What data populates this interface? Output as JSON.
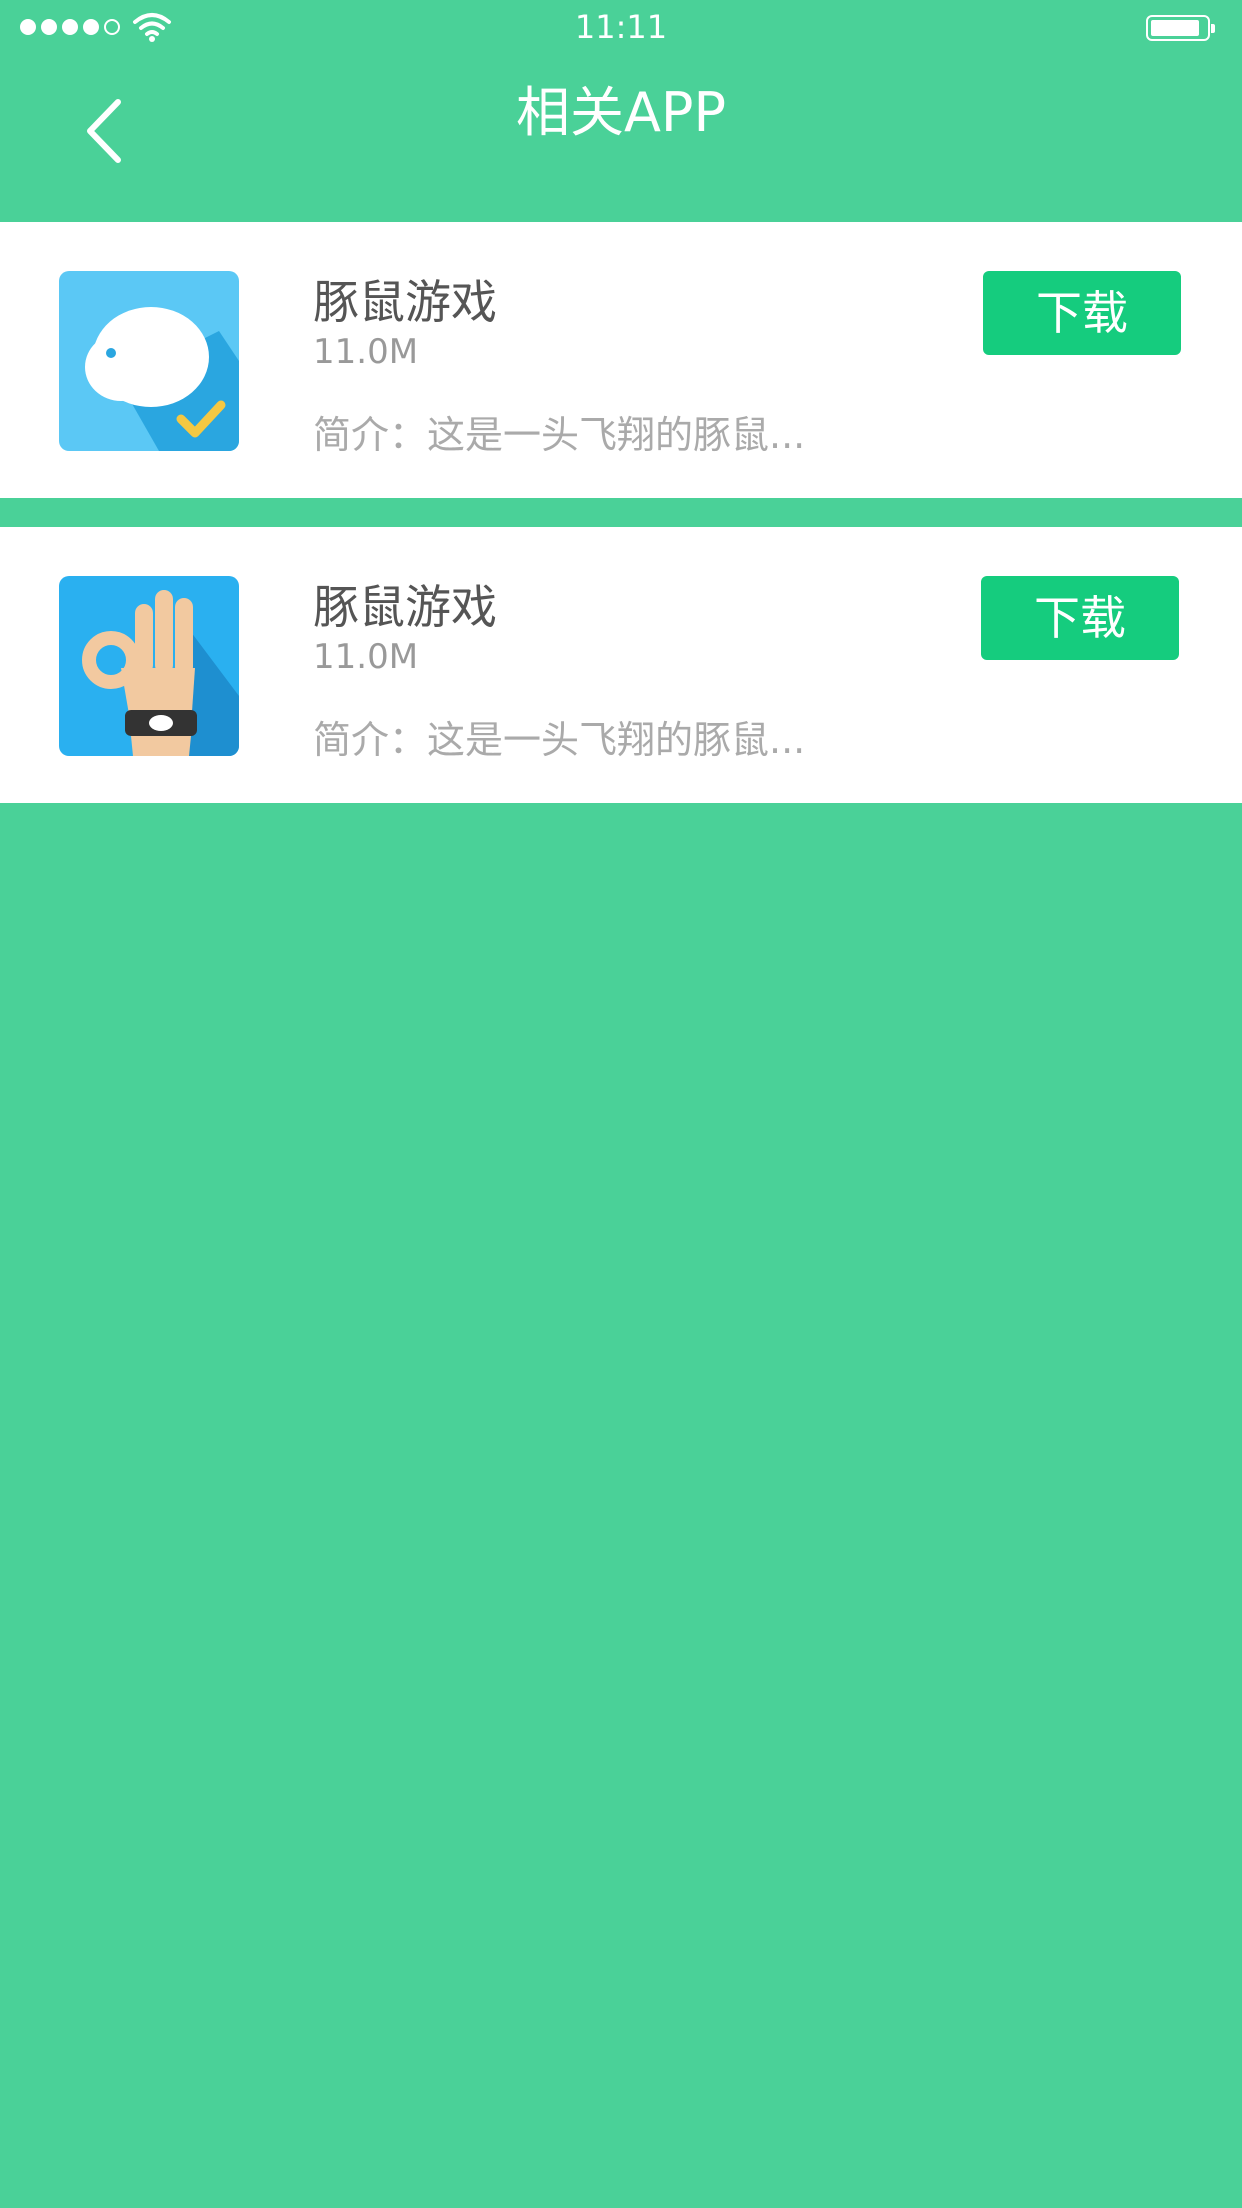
{
  "status_bar": {
    "time": "11:11",
    "signal_icon": "signal-dots-icon",
    "wifi_icon": "wifi-icon",
    "battery_icon": "battery-icon"
  },
  "header": {
    "title": "相关APP",
    "back_icon": "chevron-left-icon"
  },
  "apps": [
    {
      "name": "豚鼠游戏",
      "size": "11.0M",
      "description": "简介：这是一头飞翔的豚鼠...",
      "download_label": "下载",
      "icon": "guinea-pig-check-icon"
    },
    {
      "name": "豚鼠游戏",
      "size": "11.0M",
      "description": "简介：这是一头飞翔的豚鼠...",
      "download_label": "下载",
      "icon": "ok-hand-wristband-icon"
    }
  ],
  "colors": {
    "background": "#4ad198",
    "button": "#15cc7e",
    "card": "#ffffff"
  }
}
